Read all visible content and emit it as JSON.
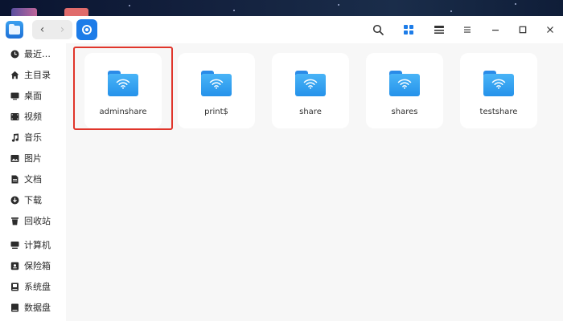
{
  "window": {
    "nav": {
      "back": "‹",
      "forward": "›"
    }
  },
  "sidebar": {
    "items": [
      {
        "label": "最近…",
        "icon": "clock-icon"
      },
      {
        "label": "主目录",
        "icon": "home-icon"
      },
      {
        "label": "桌面",
        "icon": "desktop-icon"
      },
      {
        "label": "视频",
        "icon": "video-icon"
      },
      {
        "label": "音乐",
        "icon": "music-icon"
      },
      {
        "label": "图片",
        "icon": "picture-icon"
      },
      {
        "label": "文档",
        "icon": "document-icon"
      },
      {
        "label": "下载",
        "icon": "download-icon"
      },
      {
        "label": "回收站",
        "icon": "trash-icon"
      },
      {
        "label": "计算机",
        "icon": "computer-icon"
      },
      {
        "label": "保险箱",
        "icon": "vault-icon"
      },
      {
        "label": "系统盘",
        "icon": "system-disk-icon"
      },
      {
        "label": "数据盘",
        "icon": "data-disk-icon"
      }
    ]
  },
  "content": {
    "folders": [
      {
        "name": "adminshare",
        "selected": true
      },
      {
        "name": "print$",
        "selected": false
      },
      {
        "name": "share",
        "selected": false
      },
      {
        "name": "shares",
        "selected": false
      },
      {
        "name": "testshare",
        "selected": false
      }
    ]
  },
  "colors": {
    "accent": "#1d7ce8",
    "folder": "#2592ea",
    "selection": "#e0352b"
  }
}
